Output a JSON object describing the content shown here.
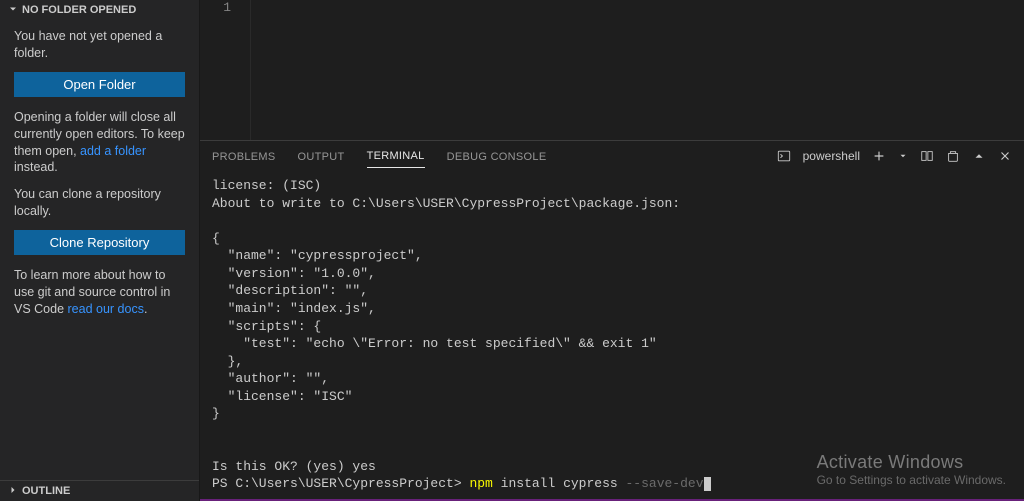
{
  "sidebar": {
    "noFolderHeader": "NO FOLDER OPENED",
    "notOpened": "You have not yet opened a folder.",
    "openFolderBtn": "Open Folder",
    "openingTextPre": "Opening a folder will close all currently open editors. To keep them open, ",
    "addFolderLink": "add a folder",
    "openingTextPost": " instead.",
    "cloneText": "You can clone a repository locally.",
    "cloneBtn": "Clone Repository",
    "learnTextPre": "To learn more about how to use git and source control in VS Code ",
    "readDocsLink": "read our docs",
    "learnTextPost": ".",
    "outlineHeader": "OUTLINE"
  },
  "editor": {
    "lineNumber": "1"
  },
  "panel": {
    "tabs": {
      "problems": "PROBLEMS",
      "output": "OUTPUT",
      "terminal": "TERMINAL",
      "debugConsole": "DEBUG CONSOLE"
    },
    "shellLabel": "powershell"
  },
  "terminal": {
    "line1": "license: (ISC)",
    "line2": "About to write to C:\\Users\\USER\\CypressProject\\package.json:",
    "blank": "",
    "jsonOpen": "{",
    "jName": "  \"name\": \"cypressproject\",",
    "jVersion": "  \"version\": \"1.0.0\",",
    "jDesc": "  \"description\": \"\",",
    "jMain": "  \"main\": \"index.js\",",
    "jScriptsOpen": "  \"scripts\": {",
    "jTest": "    \"test\": \"echo \\\"Error: no test specified\\\" && exit 1\"",
    "jScriptsClose": "  },",
    "jAuthor": "  \"author\": \"\",",
    "jLicense": "  \"license\": \"ISC\"",
    "jsonClose": "}",
    "isOk": "Is this OK? (yes) yes",
    "promptPrefix": "PS C:\\Users\\USER\\CypressProject> ",
    "cmdNpm": "npm",
    "cmdRest": " install cypress ",
    "cmdFlag": "--save-dev"
  },
  "overlay": {
    "title": "Activate Windows",
    "subtitle": "Go to Settings to activate Windows."
  }
}
